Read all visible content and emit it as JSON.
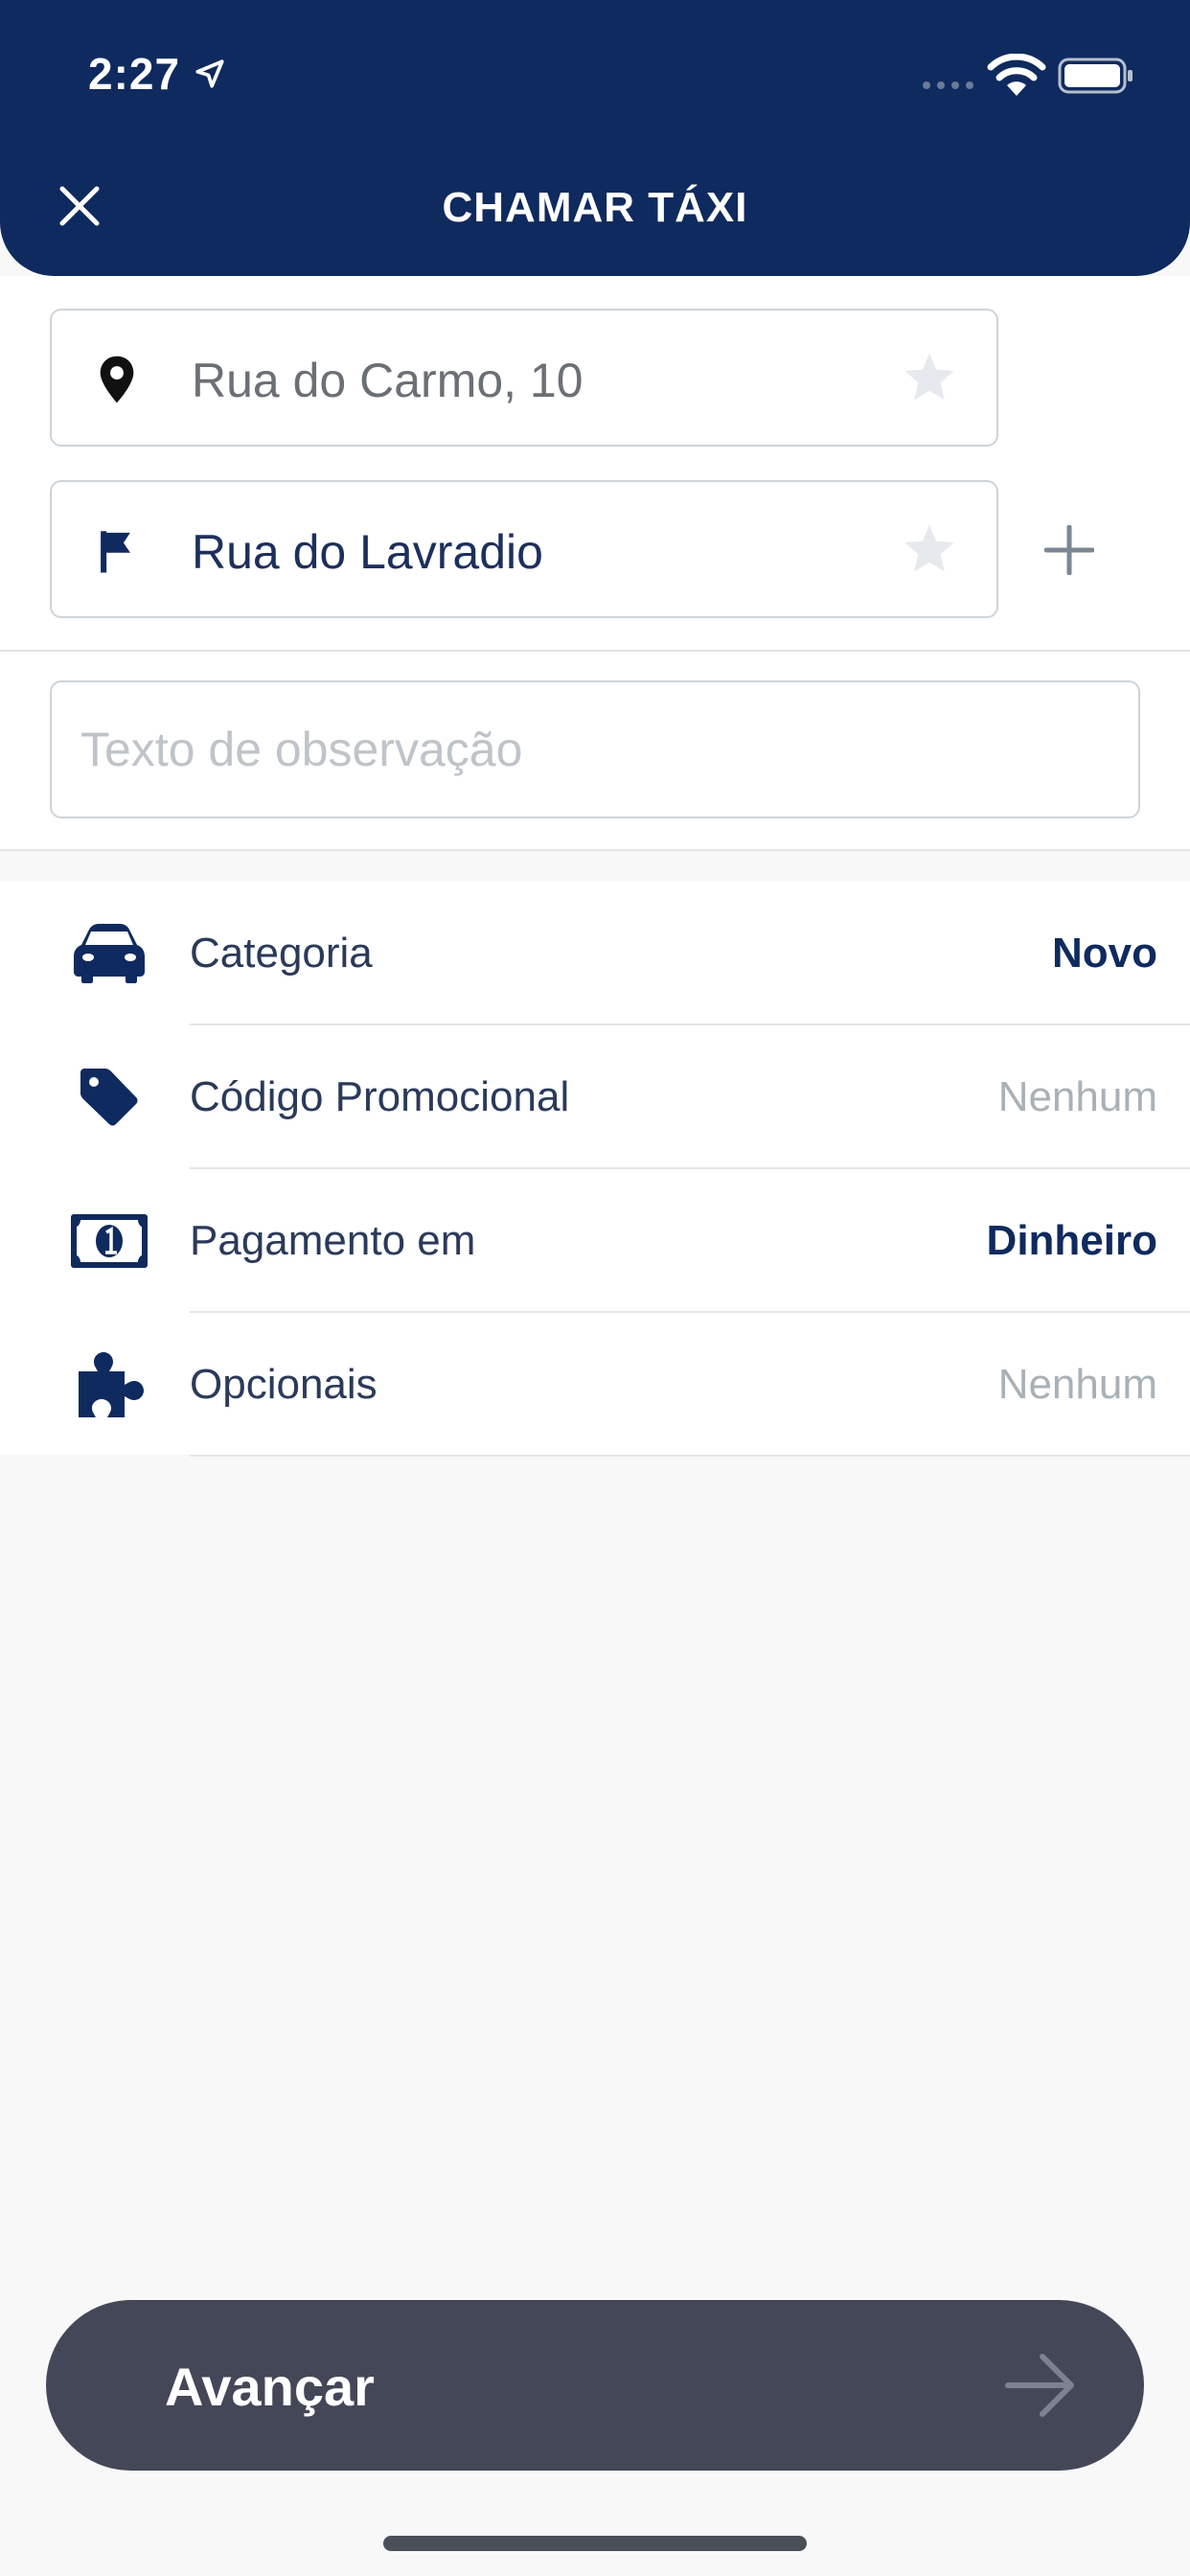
{
  "status_bar": {
    "time": "2:27"
  },
  "header": {
    "title": "CHAMAR TÁXI"
  },
  "addresses": {
    "origin": "Rua do Carmo, 10",
    "destination": "Rua do Lavradio"
  },
  "note": {
    "placeholder": "Texto de observação",
    "value": ""
  },
  "options": [
    {
      "label": "Categoria",
      "value": "Novo",
      "icon": "car-icon"
    },
    {
      "label": "Código Promocional",
      "value": "Nenhum",
      "icon": "tag-icon"
    },
    {
      "label": "Pagamento em",
      "value": "Dinheiro",
      "icon": "money-icon"
    },
    {
      "label": "Opcionais",
      "value": "Nenhum",
      "icon": "puzzle-icon"
    }
  ],
  "cta": {
    "label": "Avançar"
  },
  "colors": {
    "header_bg": "#0f2a5e",
    "cta_bg": "#434757",
    "value_strong": "#0f2a5e",
    "value_muted": "#a9b1b8"
  }
}
